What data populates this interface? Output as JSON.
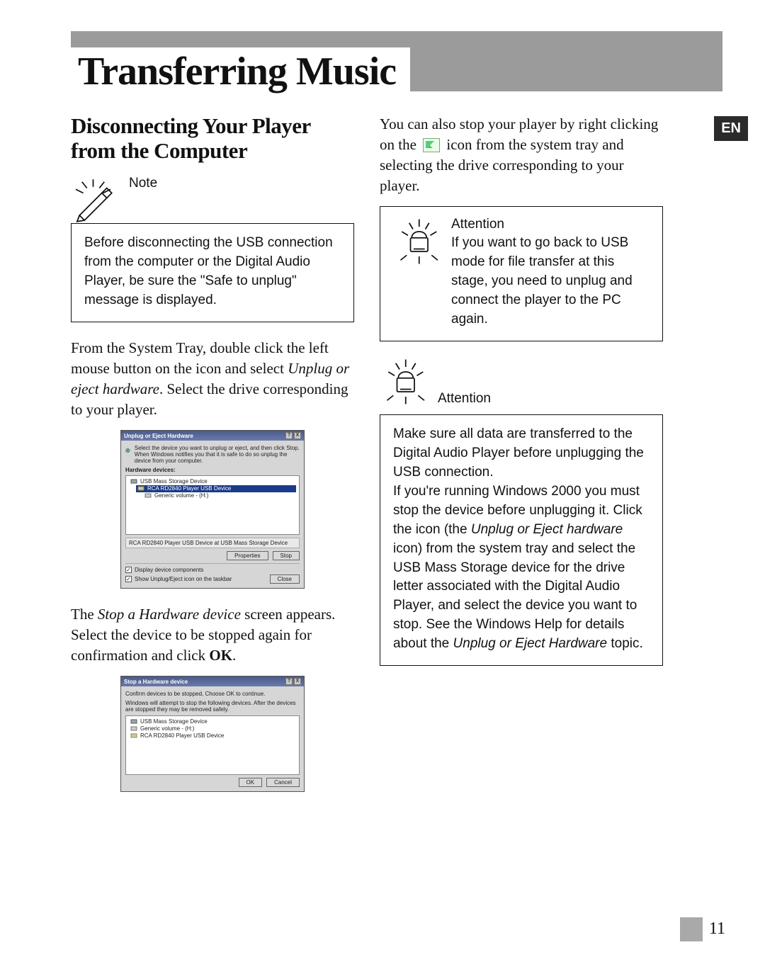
{
  "header": {
    "title": "Transferring Music"
  },
  "language_tab": "EN",
  "page_number": "11",
  "left": {
    "subhead": "Disconnecting Your Player from the Computer",
    "note": {
      "label": "Note",
      "body": "Before disconnecting the USB connection from the computer or the Digital Audio Player, be sure the \"Safe to unplug\" message is displayed."
    },
    "p1_a": "From the System Tray, double click the left mouse button on the icon and select ",
    "p1_em": "Unplug or eject hardware",
    "p1_b": ". Select the drive corresponding to your player.",
    "p2_a": "The ",
    "p2_em": "Stop a Hardware device",
    "p2_b": " screen appears. Select the device to be stopped again for confirmation and click ",
    "p2_bold": "OK",
    "p2_c": ".",
    "dialog1": {
      "title": "Unplug or Eject Hardware",
      "info": "Select the device you want to unplug or eject, and then click Stop. When Windows notifies you that it is safe to do so unplug the device from your computer.",
      "hw_label": "Hardware devices:",
      "tree": [
        "USB Mass Storage Device",
        "RCA RD2840 Player USB Device",
        "Generic volume - (H:)"
      ],
      "tree_selected_index": 1,
      "status": "RCA RD2840 Player USB Device at USB Mass Storage Device",
      "btn_properties": "Properties",
      "btn_stop": "Stop",
      "chk1": "Display device components",
      "chk2": "Show Unplug/Eject icon on the taskbar",
      "btn_close": "Close"
    },
    "dialog2": {
      "title": "Stop a Hardware device",
      "info1": "Confirm devices to be stopped, Choose OK to continue.",
      "info2": "Windows will attempt to stop the following devices. After the devices are stopped they may be removed safely.",
      "list": [
        "USB Mass Storage Device",
        "Generic volume - (H:)",
        "RCA RD2840 Player USB Device"
      ],
      "btn_ok": "OK",
      "btn_cancel": "Cancel"
    }
  },
  "right": {
    "p1_a": "You can also stop your player by right clicking on the ",
    "p1_b": " icon from the system tray and selecting the drive corresponding to your player.",
    "attn1": {
      "label": "Attention",
      "body": "If you want to go back to USB mode for file transfer at this stage, you need to unplug and connect the player to the PC again."
    },
    "attn2": {
      "label": "Attention",
      "body_a": "Make sure all data are transferred to the Digital Audio Player before unplugging the USB connection.\nIf you're running Windows 2000 you must stop the device before unplugging it. Click the icon (the ",
      "em1": "Unplug or Eject hardware",
      "body_b": " icon) from the system tray and select the USB Mass Storage device for the drive letter associated with the Digital Audio Player, and select the device you want to stop. See the Windows Help for details about the ",
      "em2": "Unplug or Eject Hardware",
      "body_c": " topic."
    }
  }
}
